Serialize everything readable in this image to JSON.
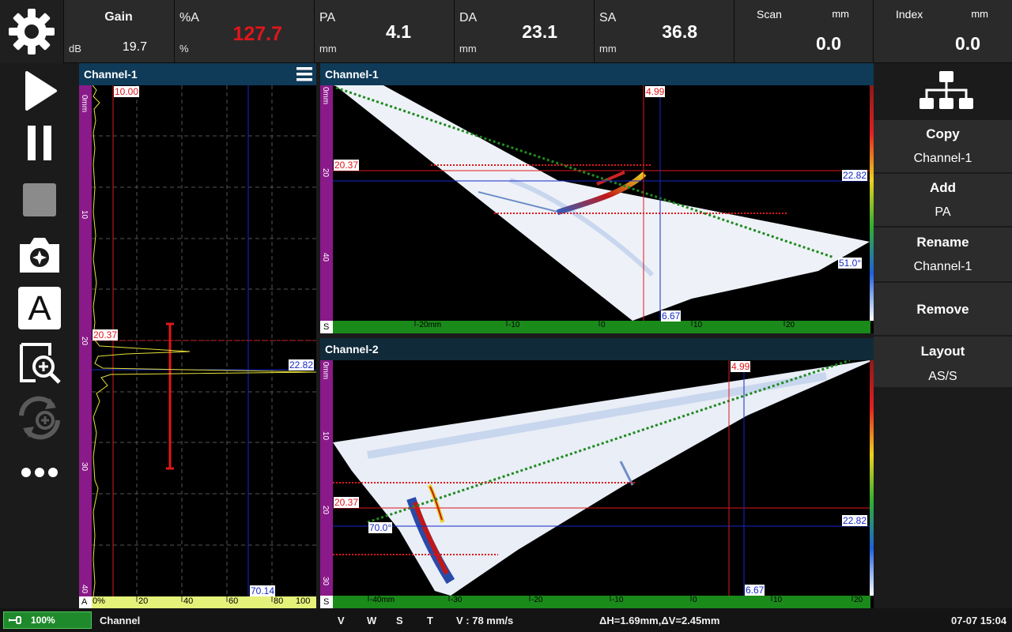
{
  "topbar": {
    "settings_icon": "gear-icon",
    "gain": {
      "label": "Gain",
      "unit": "dB",
      "value": "19.7"
    },
    "pct_a": {
      "label": "%A",
      "unit": "%",
      "value": "127.7",
      "value_color": "#e0161b"
    },
    "pa": {
      "label": "PA",
      "unit": "mm",
      "value": "4.1"
    },
    "da": {
      "label": "DA",
      "unit": "mm",
      "value": "23.1"
    },
    "sa": {
      "label": "SA",
      "unit": "mm",
      "value": "36.8"
    },
    "scan": {
      "label": "Scan",
      "unit": "mm",
      "value": "0.0"
    },
    "index": {
      "label": "Index",
      "unit": "mm",
      "value": "0.0"
    }
  },
  "toolbar": {
    "icons": [
      "play-icon",
      "pause-icon",
      "stop-icon",
      "camera-icon",
      "a-text-icon",
      "zoom-in-icon",
      "refresh-zoom-icon",
      "more-icon"
    ],
    "a_letter": "A"
  },
  "ascan": {
    "title": "Channel-1",
    "menu_icon": "hamburger-icon",
    "gate_top_label": "10.00",
    "cursor_depth_label": "20.37",
    "cursor_right_label": "22.82",
    "amp_label": "70.14",
    "y_ticks": [
      "0mm",
      "10",
      "20",
      "30",
      "40"
    ],
    "x_ticks": [
      "0%",
      "20",
      "40",
      "60",
      "80",
      "100"
    ],
    "x_axis_letter": "A"
  },
  "sscan1": {
    "title": "Channel-1",
    "cursor_top_label": "4.99",
    "depth_label": "20.37",
    "right_label": "22.82",
    "angle_label": "51.0°",
    "bottom_label": "6.67",
    "y_ticks": [
      "0mm",
      "20",
      "40"
    ],
    "x_ticks": [
      "-20mm",
      "-10",
      "0",
      "10",
      "20"
    ],
    "axis_letter": "S"
  },
  "sscan2": {
    "title": "Channel-2",
    "cursor_top_label": "4.99",
    "depth_label": "20.37",
    "right_label": "22.82",
    "angle_label": "70.0°",
    "bottom_label": "6.67",
    "y_ticks": [
      "0mm",
      "10",
      "20",
      "30"
    ],
    "x_ticks": [
      "-40mm",
      "-30",
      "-20",
      "-10",
      "0",
      "10",
      "20"
    ],
    "axis_letter": "S"
  },
  "rightmenu": {
    "layout_icon": "hierarchy-icon",
    "copy": {
      "title": "Copy",
      "sub": "Channel-1"
    },
    "add": {
      "title": "Add",
      "sub": "PA"
    },
    "rename": {
      "title": "Rename",
      "sub": "Channel-1"
    },
    "remove": {
      "title": "Remove"
    },
    "layout": {
      "title": "Layout",
      "sub": "AS/S"
    }
  },
  "statusbar": {
    "battery": "100%",
    "channel": "Channel",
    "v": "V",
    "w": "W",
    "s": "S",
    "t": "T",
    "velocity": "V : 78 mm/s",
    "delta": "ΔH=1.69mm,ΔV=2.45mm",
    "datetime": "07-07 15:04"
  },
  "colors": {
    "accent_title": "#0f3a58",
    "gate_red": "#e0161b",
    "cursor_blue": "#1428c8",
    "scale_green": "#1a8a1a",
    "depth_purple": "#8a1a8a"
  }
}
